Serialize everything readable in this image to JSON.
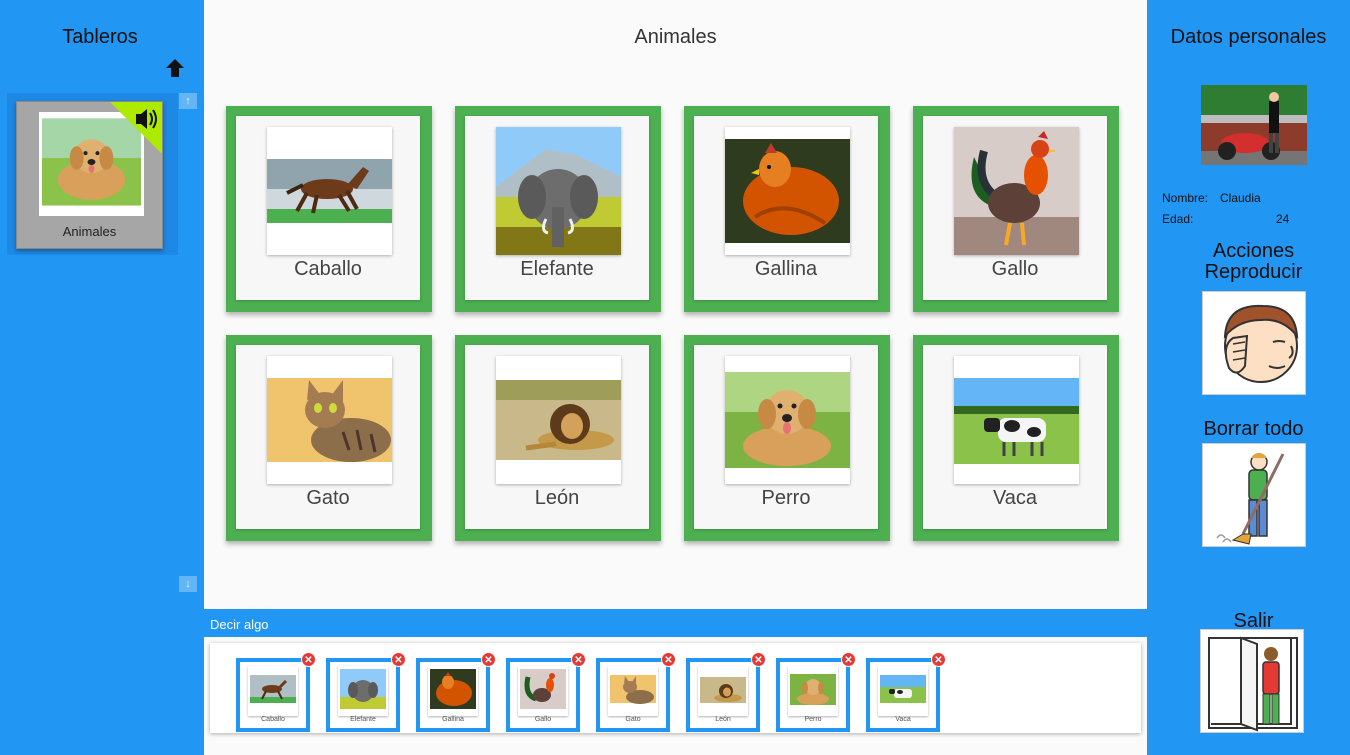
{
  "left": {
    "title": "Tableros",
    "board": {
      "label": "Animales"
    }
  },
  "center": {
    "title": "Animales",
    "tiles": [
      {
        "label": "Caballo",
        "icon": "horse-photo"
      },
      {
        "label": "Elefante",
        "icon": "elephant-photo"
      },
      {
        "label": "Gallina",
        "icon": "hen-photo"
      },
      {
        "label": "Gallo",
        "icon": "rooster-photo"
      },
      {
        "label": "Gato",
        "icon": "cat-photo"
      },
      {
        "label": "León",
        "icon": "lion-photo"
      },
      {
        "label": "Perro",
        "icon": "dog-photo"
      },
      {
        "label": "Vaca",
        "icon": "cow-photo"
      }
    ],
    "tile_color": "#4caf50"
  },
  "say": {
    "header": "Decir algo",
    "chips": [
      "Caballo",
      "Elefante",
      "Gallina",
      "Gallo",
      "Gato",
      "León",
      "Perro",
      "Vaca"
    ]
  },
  "right": {
    "title": "Datos personales",
    "name_label": "Nombre:",
    "name_value": "Claudia",
    "age_label": "Edad:",
    "age_value": "24",
    "actions_label": "Acciones",
    "play_label": "Reproducir",
    "clear_label": "Borrar todo",
    "exit_label": "Salir"
  },
  "colors": {
    "accent": "#2196f3",
    "remove": "#e53935",
    "speaker_badge": "#aeea00"
  }
}
